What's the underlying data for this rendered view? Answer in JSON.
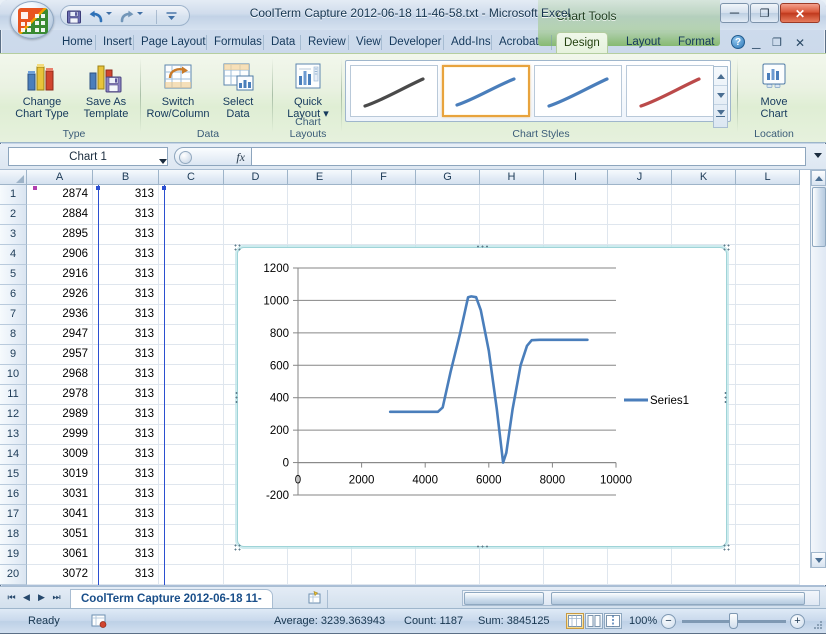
{
  "window": {
    "title": "CoolTerm Capture 2012-06-18 11-46-58.txt - Microsoft Excel",
    "contextual_tools": "Chart Tools",
    "minimize_glyph": "─",
    "restore_glyph": "❐",
    "close_glyph": "✕"
  },
  "quick_access": {
    "save": "save-icon",
    "undo": "undo-icon",
    "redo": "redo-icon",
    "customize": "customize-qat-icon"
  },
  "ribbon": {
    "tabs": [
      {
        "label": "Home",
        "active": false
      },
      {
        "label": "Insert",
        "active": false
      },
      {
        "label": "Page Layout",
        "active": false
      },
      {
        "label": "Formulas",
        "active": false
      },
      {
        "label": "Data",
        "active": false
      },
      {
        "label": "Review",
        "active": false
      },
      {
        "label": "View",
        "active": false
      },
      {
        "label": "Developer",
        "active": false
      },
      {
        "label": "Add-Ins",
        "active": false
      },
      {
        "label": "Acrobat",
        "active": false
      },
      {
        "label": "Design",
        "active": true
      },
      {
        "label": "Layout",
        "active": false
      },
      {
        "label": "Format",
        "active": false
      }
    ],
    "help_glyph": "?",
    "minimize_ribbon_glyph": "─",
    "restore_ribbon_glyph": "❐",
    "close_window_glyph": "✕",
    "groups": [
      {
        "name": "Type",
        "buttons": [
          {
            "label_line1": "Change",
            "label_line2": "Chart Type",
            "icon": "change-chart-type-icon"
          },
          {
            "label_line1": "Save As",
            "label_line2": "Template",
            "icon": "save-as-template-icon"
          }
        ]
      },
      {
        "name": "Data",
        "buttons": [
          {
            "label_line1": "Switch",
            "label_line2": "Row/Column",
            "icon": "switch-row-column-icon"
          },
          {
            "label_line1": "Select",
            "label_line2": "Data",
            "icon": "select-data-icon"
          }
        ]
      },
      {
        "name": "Chart Layouts",
        "buttons": [
          {
            "label_line1": "Quick",
            "label_line2": "Layout ▾",
            "icon": "quick-layout-icon"
          }
        ]
      },
      {
        "name": "Chart Styles",
        "gallery": [
          {
            "color": "#4a4a4a",
            "selected": false
          },
          {
            "color": "#4a7ebb",
            "selected": true
          },
          {
            "color": "#4a7ebb",
            "selected": false
          },
          {
            "color": "#bb4a4a",
            "selected": false
          }
        ]
      },
      {
        "name": "Location",
        "buttons": [
          {
            "label_line1": "Move",
            "label_line2": "Chart",
            "icon": "move-chart-icon"
          }
        ]
      }
    ]
  },
  "formula_bar": {
    "name_box_value": "Chart 1",
    "fx_label": "fx",
    "formula_value": ""
  },
  "grid": {
    "columns": [
      "A",
      "B",
      "C",
      "D",
      "E",
      "F",
      "G",
      "H",
      "I",
      "J",
      "K",
      "L"
    ],
    "rows": [
      {
        "n": "1",
        "A": "2874",
        "B": "313"
      },
      {
        "n": "2",
        "A": "2884",
        "B": "313"
      },
      {
        "n": "3",
        "A": "2895",
        "B": "313"
      },
      {
        "n": "4",
        "A": "2906",
        "B": "313"
      },
      {
        "n": "5",
        "A": "2916",
        "B": "313"
      },
      {
        "n": "6",
        "A": "2926",
        "B": "313"
      },
      {
        "n": "7",
        "A": "2936",
        "B": "313"
      },
      {
        "n": "8",
        "A": "2947",
        "B": "313"
      },
      {
        "n": "9",
        "A": "2957",
        "B": "313"
      },
      {
        "n": "10",
        "A": "2968",
        "B": "313"
      },
      {
        "n": "11",
        "A": "2978",
        "B": "313"
      },
      {
        "n": "12",
        "A": "2989",
        "B": "313"
      },
      {
        "n": "13",
        "A": "2999",
        "B": "313"
      },
      {
        "n": "14",
        "A": "3009",
        "B": "313"
      },
      {
        "n": "15",
        "A": "3019",
        "B": "313"
      },
      {
        "n": "16",
        "A": "3031",
        "B": "313"
      },
      {
        "n": "17",
        "A": "3041",
        "B": "313"
      },
      {
        "n": "18",
        "A": "3051",
        "B": "313"
      },
      {
        "n": "19",
        "A": "3061",
        "B": "313"
      },
      {
        "n": "20",
        "A": "3072",
        "B": "313"
      }
    ]
  },
  "sheet_tabs": {
    "first_glyph": "⏮",
    "prev_glyph": "◀",
    "next_glyph": "▶",
    "last_glyph": "⏭",
    "tabs": [
      {
        "label": "CoolTerm Capture 2012-06-18 11-",
        "active": true
      }
    ],
    "new_sheet_icon": "new-sheet-icon"
  },
  "status_bar": {
    "mode": "Ready",
    "macro_icon": "record-macro-icon",
    "average": "Average: 3239.363943",
    "count": "Count: 1187",
    "sum": "Sum: 3845125",
    "views": [
      {
        "name": "normal-view",
        "icon": "normal-view-icon",
        "active": true
      },
      {
        "name": "page-layout-view",
        "icon": "page-layout-view-icon",
        "active": false
      },
      {
        "name": "page-break-view",
        "icon": "page-break-preview-icon",
        "active": false
      }
    ],
    "zoom": "100%",
    "zoom_out_glyph": "−",
    "zoom_in_glyph": "+"
  },
  "chart_data": {
    "type": "line",
    "title": "",
    "xlabel": "",
    "ylabel": "",
    "series_name": "Series1",
    "legend": [
      "Series1"
    ],
    "legend_position": "right",
    "grid": true,
    "line_color": "#4a7ebb",
    "xlim": [
      0,
      10000
    ],
    "ylim": [
      -200,
      1200
    ],
    "xticks": [
      0,
      2000,
      4000,
      6000,
      8000,
      10000
    ],
    "yticks": [
      -200,
      0,
      200,
      400,
      600,
      800,
      1000,
      1200
    ],
    "x": [
      2900,
      3500,
      4000,
      4400,
      4550,
      4800,
      5100,
      5350,
      5450,
      5600,
      5750,
      6000,
      6250,
      6450,
      6550,
      6750,
      7000,
      7200,
      7350,
      7600,
      8000,
      8600,
      9100
    ],
    "y": [
      313,
      313,
      313,
      313,
      340,
      560,
      800,
      1020,
      1025,
      1020,
      940,
      690,
      330,
      0,
      60,
      330,
      600,
      720,
      755,
      757,
      757,
      757,
      757
    ]
  }
}
